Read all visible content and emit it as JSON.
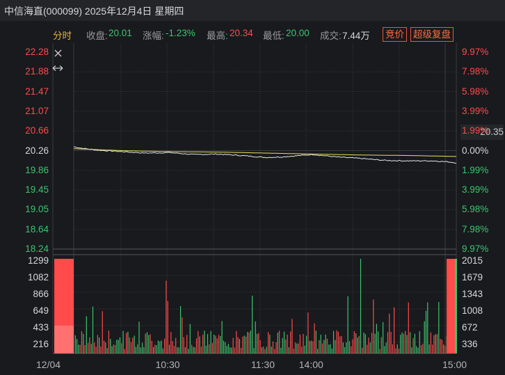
{
  "title": "中信海直(000099) 2025年12月4日 星期四",
  "info": {
    "mode_label": "分时",
    "close_label": "收盘:",
    "close_value": "20.01",
    "change_label": "涨幅:",
    "change_value": "-1.23%",
    "high_label": "最高:",
    "high_value": "20.34",
    "low_label": "最低:",
    "low_value": "20.00",
    "volume_label": "成交:",
    "volume_value": "7.44万"
  },
  "buttons": {
    "auction": "竞价",
    "super_replay": "超级复盘"
  },
  "icons": [
    "close-icon",
    "horizontal-resize-icon"
  ],
  "colors": {
    "up": "#ff4b4b",
    "down": "#3ec46d",
    "price_line": "#e6e6e6",
    "avg_line": "#e8e05a",
    "grid": "#3a3c40",
    "accent_button": "#e85a3a"
  },
  "price_tag": "20.35",
  "chart_data": {
    "type": "line",
    "price_axis_left": [
      "22.28",
      "21.88",
      "21.47",
      "21.07",
      "20.66",
      "20.26",
      "19.86",
      "19.45",
      "19.05",
      "18.64",
      "18.24"
    ],
    "price_axis_right": [
      "9.97%",
      "7.98%",
      "5.98%",
      "3.99%",
      "1.99%",
      "0.00%",
      "1.99%",
      "3.99%",
      "5.98%",
      "7.98%",
      "9.97%"
    ],
    "ylim": [
      18.24,
      22.28
    ],
    "prev_close": 20.26,
    "volume_axis_left": [
      "1299",
      "1082",
      "866",
      "649",
      "433",
      "216"
    ],
    "volume_axis_right": [
      "2015",
      "1679",
      "1343",
      "1008",
      "672",
      "336"
    ],
    "x_ticks": [
      "12/04",
      "10:30",
      "11:30",
      "14:00",
      "15:00"
    ],
    "series": [
      {
        "x": [
          "09:30",
          "09:35",
          "09:45",
          "10:00",
          "10:15",
          "10:30",
          "10:45",
          "11:00",
          "11:15",
          "11:30",
          "13:10",
          "13:30",
          "13:45",
          "14:00",
          "14:15",
          "14:30",
          "14:45",
          "14:55",
          "15:00"
        ],
        "values": [
          20.34,
          20.31,
          20.27,
          20.24,
          20.21,
          20.22,
          20.18,
          20.19,
          20.16,
          20.12,
          20.13,
          20.18,
          20.13,
          20.1,
          20.06,
          20.05,
          20.05,
          20.03,
          20.01
        ]
      },
      {
        "x": [
          "09:30",
          "10:00",
          "10:30",
          "11:00",
          "11:30",
          "13:30",
          "14:00",
          "14:30",
          "15:00"
        ],
        "values": [
          20.3,
          20.26,
          20.24,
          20.23,
          20.21,
          20.19,
          20.17,
          20.16,
          20.14
        ]
      }
    ]
  }
}
